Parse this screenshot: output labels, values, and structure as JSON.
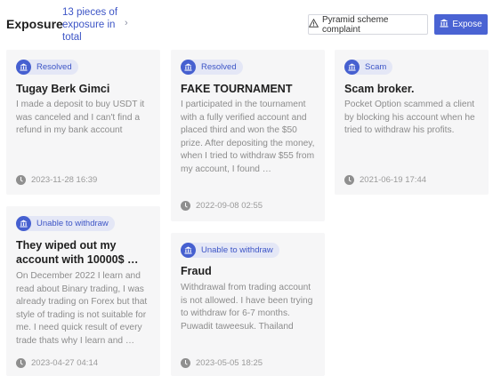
{
  "header": {
    "title": "Exposure",
    "count_text": "13 pieces of exposure in total",
    "chevron": "›",
    "complaint_button": "Pyramid scheme complaint",
    "expose_button": "Expose"
  },
  "cards": [
    {
      "status": "Resolved",
      "title": "Tugay Berk Gimci",
      "body": "I made a deposit to buy USDT it was canceled and I can't find a refund in my bank account",
      "date": "2023-11-28 16:39"
    },
    {
      "status": "Resolved",
      "title": "FAKE TOURNAMENT",
      "body": "I participated in the tournament with a fully verified account and placed third and won the $50 prize. After depositing the money, when I tried to withdraw $55 from my account, I found …",
      "date": "2022-09-08 02:55"
    },
    {
      "status": "Scam",
      "title": "Scam broker.",
      "body": "Pocket Option scammed a client by blocking his account when he tried to withdraw his profits.",
      "date": "2021-06-19 17:44"
    },
    {
      "status": "Unable to withdraw",
      "title": "They wiped out my account with 10000$ …",
      "body": "On December 2022 I learn and read about Binary trading, I was already trading on Forex but that style of trading is not suitable for me. I need quick result of every trade thats why I learn and …",
      "date": "2023-04-27 04:14"
    },
    {
      "status": "Unable to withdraw",
      "title": "Fraud",
      "body": "Withdrawal from trading account is not allowed. I have been trying to withdraw for 6-7 months. Puwadit taweesuk. Thailand",
      "date": "2023-05-05 18:25"
    }
  ],
  "colors": {
    "accent": "#4a63d3",
    "badge_bg": "#e4e7f6",
    "card_bg": "#f6f6f7"
  },
  "icons": {
    "badge": "bank-icon",
    "date": "clock-icon",
    "complaint": "warning-icon",
    "expose": "bank-icon"
  }
}
